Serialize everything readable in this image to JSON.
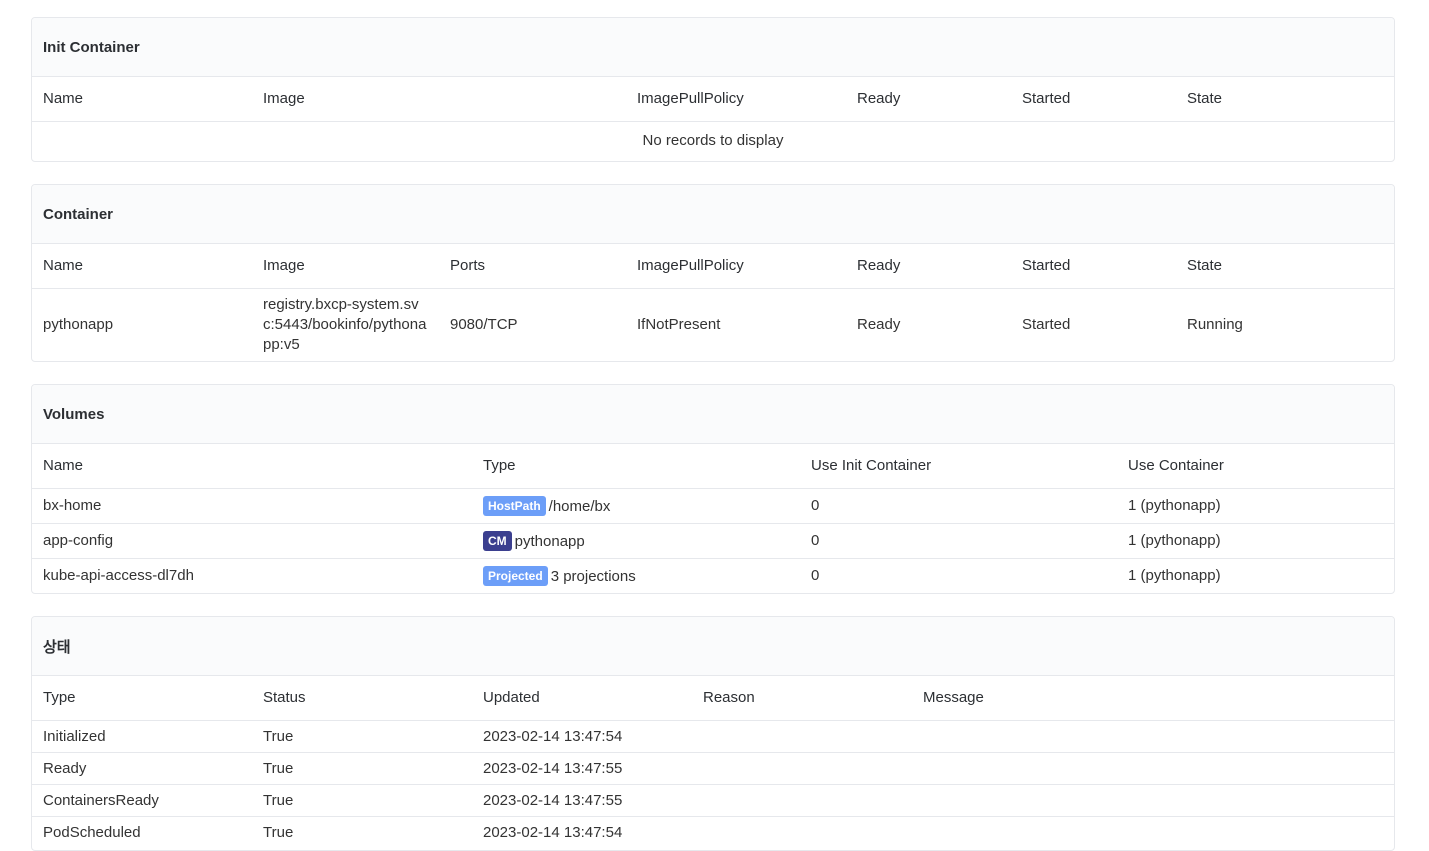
{
  "init_container": {
    "title": "Init Container",
    "columns": [
      "Name",
      "Image",
      "ImagePullPolicy",
      "Ready",
      "Started",
      "State"
    ],
    "empty_text": "No records to display"
  },
  "container": {
    "title": "Container",
    "columns": [
      "Name",
      "Image",
      "Ports",
      "ImagePullPolicy",
      "Ready",
      "Started",
      "State"
    ],
    "rows": [
      {
        "name": "pythonapp",
        "image": "registry.bxcp-system.svc:5443/bookinfo/pythonapp:v5",
        "ports": "9080/TCP",
        "policy": "IfNotPresent",
        "ready": "Ready",
        "started": "Started",
        "state": "Running"
      }
    ]
  },
  "volumes": {
    "title": "Volumes",
    "columns": [
      "Name",
      "Type",
      "Use Init Container",
      "Use Container"
    ],
    "rows": [
      {
        "name": "bx-home",
        "badge": "HostPath",
        "badge_color": "#6c9ef8",
        "type_text": "/home/bx",
        "init": "0",
        "container": "1 (pythonapp)"
      },
      {
        "name": "app-config",
        "badge": "CM",
        "badge_color": "#3b3f8f",
        "type_text": "pythonapp",
        "init": "0",
        "container": "1 (pythonapp)"
      },
      {
        "name": "kube-api-access-dl7dh",
        "badge": "Projected",
        "badge_color": "#6c9ef8",
        "type_text": "3 projections",
        "init": "0",
        "container": "1 (pythonapp)"
      }
    ]
  },
  "status": {
    "title": "상태",
    "columns": [
      "Type",
      "Status",
      "Updated",
      "Reason",
      "Message"
    ],
    "rows": [
      {
        "type": "Initialized",
        "status": "True",
        "updated": "2023-02-14 13:47:54",
        "reason": "",
        "message": ""
      },
      {
        "type": "Ready",
        "status": "True",
        "updated": "2023-02-14 13:47:55",
        "reason": "",
        "message": ""
      },
      {
        "type": "ContainersReady",
        "status": "True",
        "updated": "2023-02-14 13:47:55",
        "reason": "",
        "message": ""
      },
      {
        "type": "PodScheduled",
        "status": "True",
        "updated": "2023-02-14 13:47:54",
        "reason": "",
        "message": ""
      }
    ]
  }
}
